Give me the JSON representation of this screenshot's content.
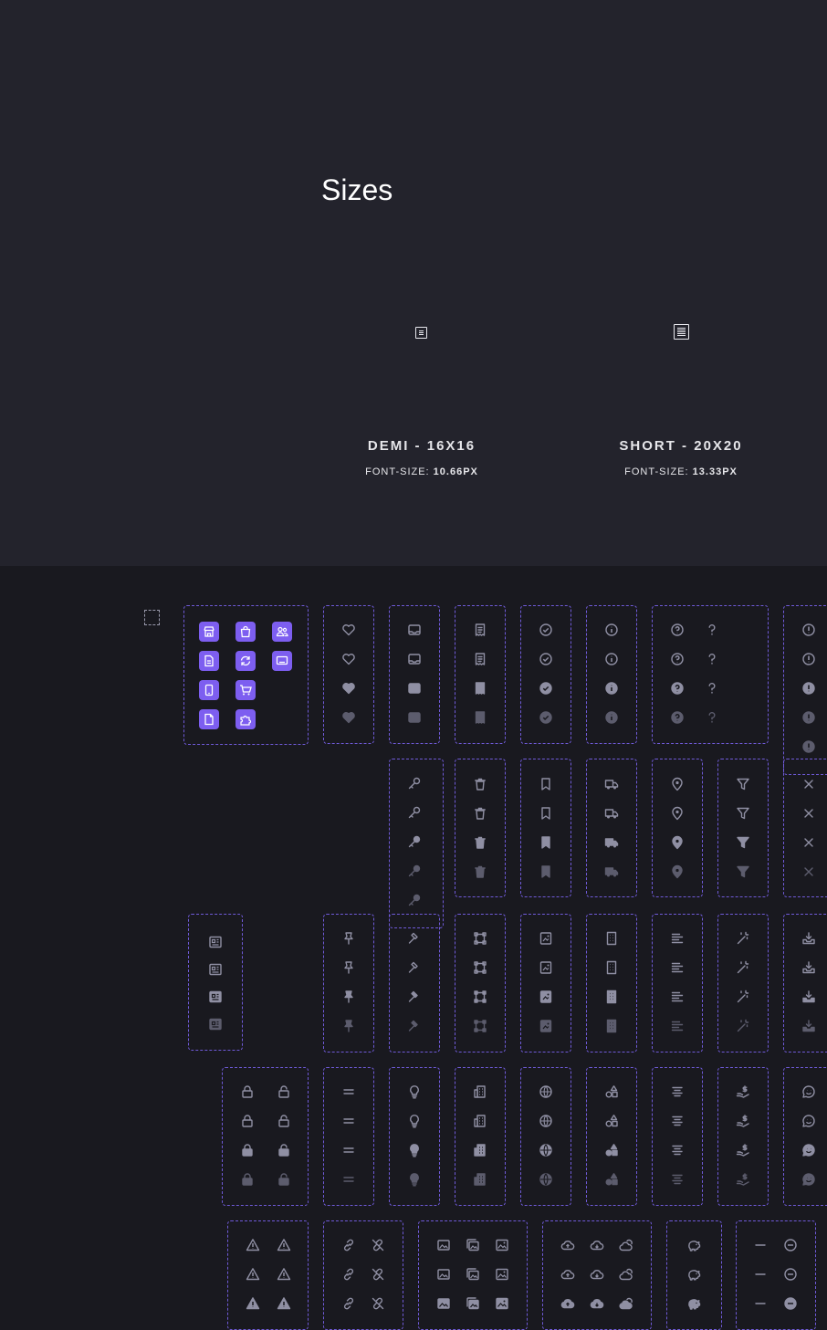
{
  "title": "Sizes",
  "sizes": [
    {
      "name": "DEMI - 16X16",
      "font_prefix": "FONT-SIZE:",
      "font_value": "10.66PX"
    },
    {
      "name": "SHORT - 20X20",
      "font_prefix": "FONT-SIZE:",
      "font_value": "13.33PX"
    }
  ],
  "colors": {
    "top_bg": "#23232c",
    "page_bg": "#19191f",
    "accent": "#7d5ef0",
    "dashed_border": "#6f5ad8",
    "icon_gray": "#8f8fa3"
  },
  "icon_groups": [
    {
      "name": "brand-tiles",
      "icons": [
        "store",
        "shopping-bag",
        "users",
        "document",
        "refresh",
        "monitor",
        "phone",
        "cart",
        "file",
        "puzzle"
      ]
    },
    {
      "name": "heart",
      "icons": [
        "heart"
      ]
    },
    {
      "name": "inbox",
      "icons": [
        "inbox"
      ]
    },
    {
      "name": "receipt",
      "icons": [
        "receipt"
      ]
    },
    {
      "name": "check-circle",
      "icons": [
        "check-circle"
      ]
    },
    {
      "name": "info-circle",
      "icons": [
        "info-circle"
      ]
    },
    {
      "name": "question",
      "icons": [
        "question-circle",
        "question"
      ]
    },
    {
      "name": "exclamation-circle",
      "icons": [
        "exclamation-circle"
      ]
    },
    {
      "name": "key",
      "icons": [
        "key"
      ]
    },
    {
      "name": "trash",
      "icons": [
        "trash"
      ]
    },
    {
      "name": "bookmark",
      "icons": [
        "bookmark"
      ]
    },
    {
      "name": "truck",
      "icons": [
        "truck"
      ]
    },
    {
      "name": "map-pin",
      "icons": [
        "map-pin"
      ]
    },
    {
      "name": "filter",
      "icons": [
        "filter"
      ]
    },
    {
      "name": "close",
      "icons": [
        "close"
      ]
    },
    {
      "name": "newspaper",
      "icons": [
        "newspaper"
      ]
    },
    {
      "name": "pin",
      "icons": [
        "pin"
      ]
    },
    {
      "name": "hammer",
      "icons": [
        "hammer"
      ]
    },
    {
      "name": "vector",
      "icons": [
        "vector"
      ]
    },
    {
      "name": "image-frame",
      "icons": [
        "image-frame"
      ]
    },
    {
      "name": "building",
      "icons": [
        "building"
      ]
    },
    {
      "name": "align-left",
      "icons": [
        "align-left"
      ]
    },
    {
      "name": "magic-wand",
      "icons": [
        "magic-wand"
      ]
    },
    {
      "name": "download-tray",
      "icons": [
        "download-tray"
      ]
    },
    {
      "name": "lock",
      "icons": [
        "lock",
        "unlock"
      ]
    },
    {
      "name": "equals",
      "icons": [
        "equals"
      ]
    },
    {
      "name": "lightbulb",
      "icons": [
        "lightbulb"
      ]
    },
    {
      "name": "office",
      "icons": [
        "office"
      ]
    },
    {
      "name": "globe",
      "icons": [
        "globe"
      ]
    },
    {
      "name": "shapes",
      "icons": [
        "shapes"
      ]
    },
    {
      "name": "align-center",
      "icons": [
        "align-center"
      ]
    },
    {
      "name": "hand-dollar",
      "icons": [
        "hand-dollar"
      ]
    },
    {
      "name": "chat-smile",
      "icons": [
        "chat-smile"
      ]
    },
    {
      "name": "warning",
      "icons": [
        "warning"
      ]
    },
    {
      "name": "link",
      "icons": [
        "link",
        "unlink"
      ]
    },
    {
      "name": "images",
      "icons": [
        "image",
        "images",
        "gallery"
      ]
    },
    {
      "name": "cloud",
      "icons": [
        "cloud-upload",
        "cloud-download",
        "cloud-sun"
      ]
    },
    {
      "name": "piggy-bank",
      "icons": [
        "piggy-bank"
      ]
    },
    {
      "name": "minus",
      "icons": [
        "minus",
        "minus-circle"
      ]
    }
  ]
}
